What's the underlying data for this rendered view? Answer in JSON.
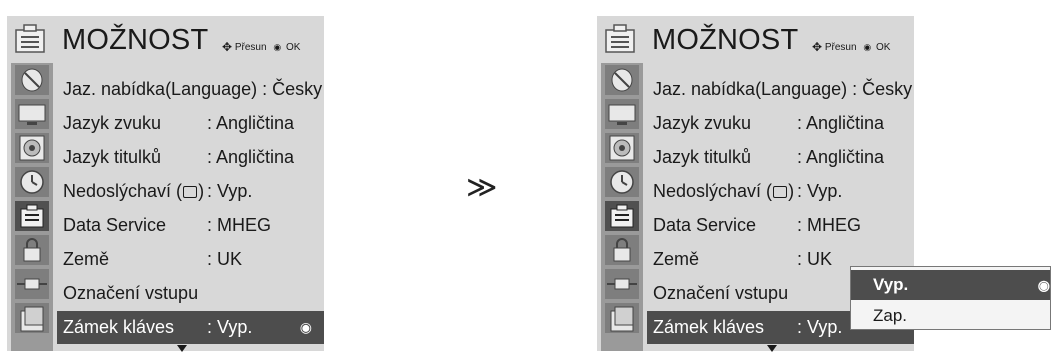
{
  "title": "MOŽNOST",
  "hint": {
    "move": "Přesun",
    "ok": "OK"
  },
  "arrow": "≫",
  "menu": [
    {
      "label": "Jaz. nabídka(Language)",
      "value": "Česky"
    },
    {
      "label": "Jazyk zvuku",
      "value": "Angličtina"
    },
    {
      "label": "Jazyk titulků",
      "value": "Angličtina"
    },
    {
      "label_pre": "Nedoslýchaví (",
      "label_post": ")",
      "value": "Vyp."
    },
    {
      "label": "Data Service",
      "value": "MHEG"
    },
    {
      "label": "Země",
      "value": "UK"
    },
    {
      "label": "Označení vstupu",
      "value": ""
    },
    {
      "label": "Zámek kláves",
      "value": "Vyp."
    }
  ],
  "popup": {
    "options": [
      "Vyp.",
      "Zap."
    ],
    "selected": "Vyp."
  },
  "icons": [
    "option-menu-icon",
    "satellite-dish-icon",
    "monitor-icon",
    "speaker-icon",
    "clock-icon",
    "option-menu-icon",
    "lock-icon",
    "input-plug-icon",
    "usb-photo-icon"
  ]
}
